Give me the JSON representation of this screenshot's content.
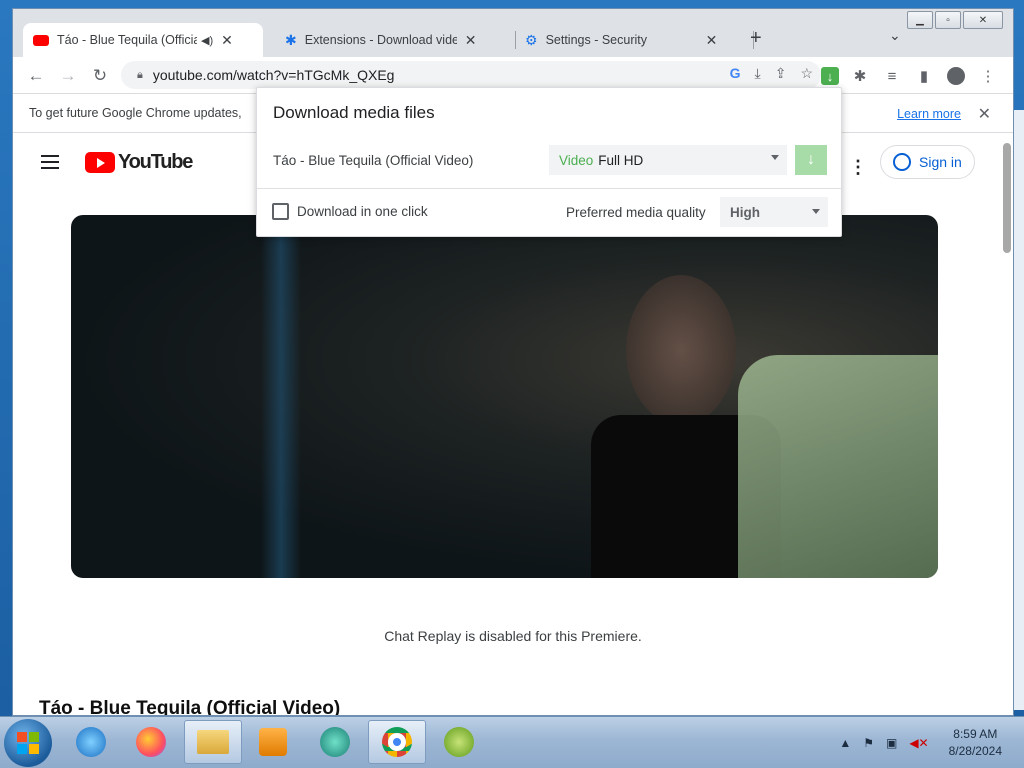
{
  "browser": {
    "tabs": [
      {
        "label": "Táo - Blue Tequila (Official Video)",
        "close": "✕"
      },
      {
        "label": "Extensions - Download video & audio",
        "close": "✕"
      },
      {
        "label": "Settings - Security",
        "close": "✕"
      }
    ],
    "new_tab": "+",
    "url": "youtube.com/watch?v=hTGcMk_QXEg"
  },
  "infobar": {
    "message": "To get future Google Chrome updates,",
    "learn_more": "Learn more",
    "close": "✕"
  },
  "youtube": {
    "logo_text": "YouTube",
    "sign_in": "Sign in",
    "chat_replay": "Chat Replay is disabled for this Premiere.",
    "video_title": "Táo - Blue Tequila (Official Video)"
  },
  "popup": {
    "heading": "Download media files",
    "media_name": "Táo - Blue Tequila (Official Video)",
    "media_kind": "Video",
    "media_quality": "Full HD",
    "one_click_label": "Download in one click",
    "preferred_label": "Preferred media quality",
    "preferred_value": "High"
  },
  "taskbar": {
    "time": "8:59 AM",
    "date": "8/28/2024"
  },
  "colors": {
    "accent_green": "#4caf50",
    "youtube_red": "#ff0000",
    "link_blue": "#1a73e8"
  }
}
